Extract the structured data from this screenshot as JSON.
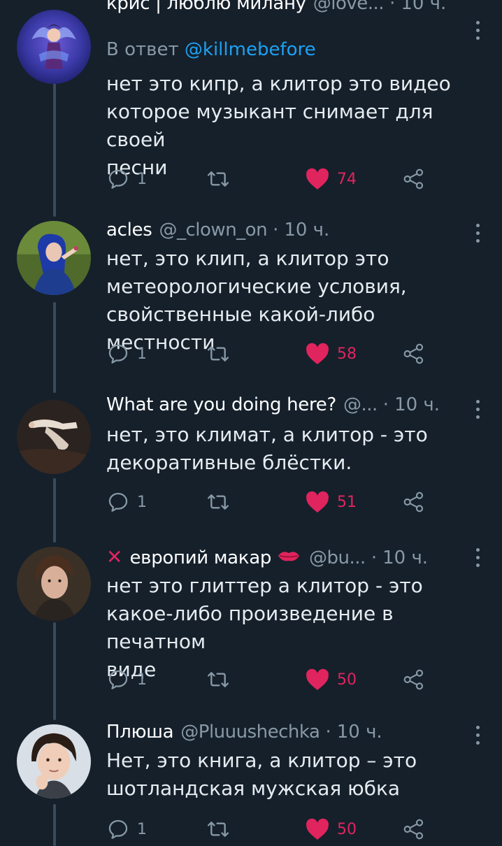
{
  "tweets": [
    {
      "name": "крис | люблю милану",
      "handle": "@love...",
      "time": "10 ч.",
      "reply_label": "В ответ",
      "reply_mention": "@killmebefore",
      "body_lines": [
        "нет это кипр, а клитор это видео",
        "которое музыкант снимает для своей",
        "песни"
      ],
      "replies": "1",
      "likes": "74"
    },
    {
      "name": "acles",
      "handle": "@_clown_on",
      "time": "10 ч.",
      "body_lines": [
        "нет, это клип, а клитор это",
        "метеорологические условия,",
        "свойственные какой-либо местности"
      ],
      "replies": "1",
      "likes": "58"
    },
    {
      "name": "What are you doing here?",
      "handle": "@...",
      "time": "10 ч.",
      "body_lines": [
        "нет, это климат, а клитор - это",
        "декоративные блёстки."
      ],
      "replies": "1",
      "likes": "51"
    },
    {
      "name": "европий макар",
      "handle": "@bu...",
      "time": "10 ч.",
      "body_lines": [
        "нет это глиттер а клитор - это",
        "какое-либо произведение в печатном",
        "виде"
      ],
      "replies": "1",
      "likes": "50"
    },
    {
      "name": "Плюша",
      "handle": "@Pluuushechka",
      "time": "10 ч.",
      "body_lines": [
        "Нет, это книга, а клитор – это",
        "шотландская мужская юбка"
      ],
      "replies": "1",
      "likes": "50"
    }
  ],
  "separator": "·",
  "icons": {
    "reply": "reply-icon",
    "retweet": "retweet-icon",
    "like": "heart-icon",
    "share": "share-icon",
    "more": "more-vertical-icon"
  },
  "colors": {
    "background": "#15202b",
    "primary_text": "#e6ecf0",
    "secondary_text": "#8899a6",
    "link": "#1da1f2",
    "like": "#e0245e",
    "thread_line": "#3a4b5c"
  }
}
